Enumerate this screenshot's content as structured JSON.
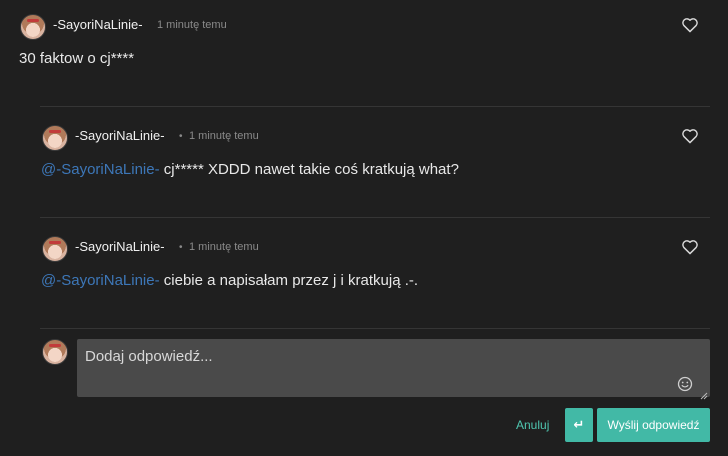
{
  "top_comment": {
    "username": "-SayoriNaLinie-",
    "time": "1 minutę temu",
    "text": "30 faktow o cj****"
  },
  "replies": [
    {
      "username": "-SayoriNaLinie-",
      "separator": "•",
      "time": "1 minutę temu",
      "mention": "@-SayoriNaLinie-",
      "text": "cj***** XDDD nawet takie coś kratkują what?"
    },
    {
      "username": "-SayoriNaLinie-",
      "separator": "•",
      "time": "1 minutę temu",
      "mention": "@-SayoriNaLinie-",
      "text": "ciebie a napisałam przez j i kratkują .-."
    }
  ],
  "reply_form": {
    "placeholder": "Dodaj odpowiedź...",
    "cancel_label": "Anuluj",
    "enter_label": "↵",
    "send_label": "Wyślij odpowiedź"
  },
  "colors": {
    "background": "#1f1f1f",
    "accent": "#42b9a6",
    "mention": "#3d77b8"
  }
}
